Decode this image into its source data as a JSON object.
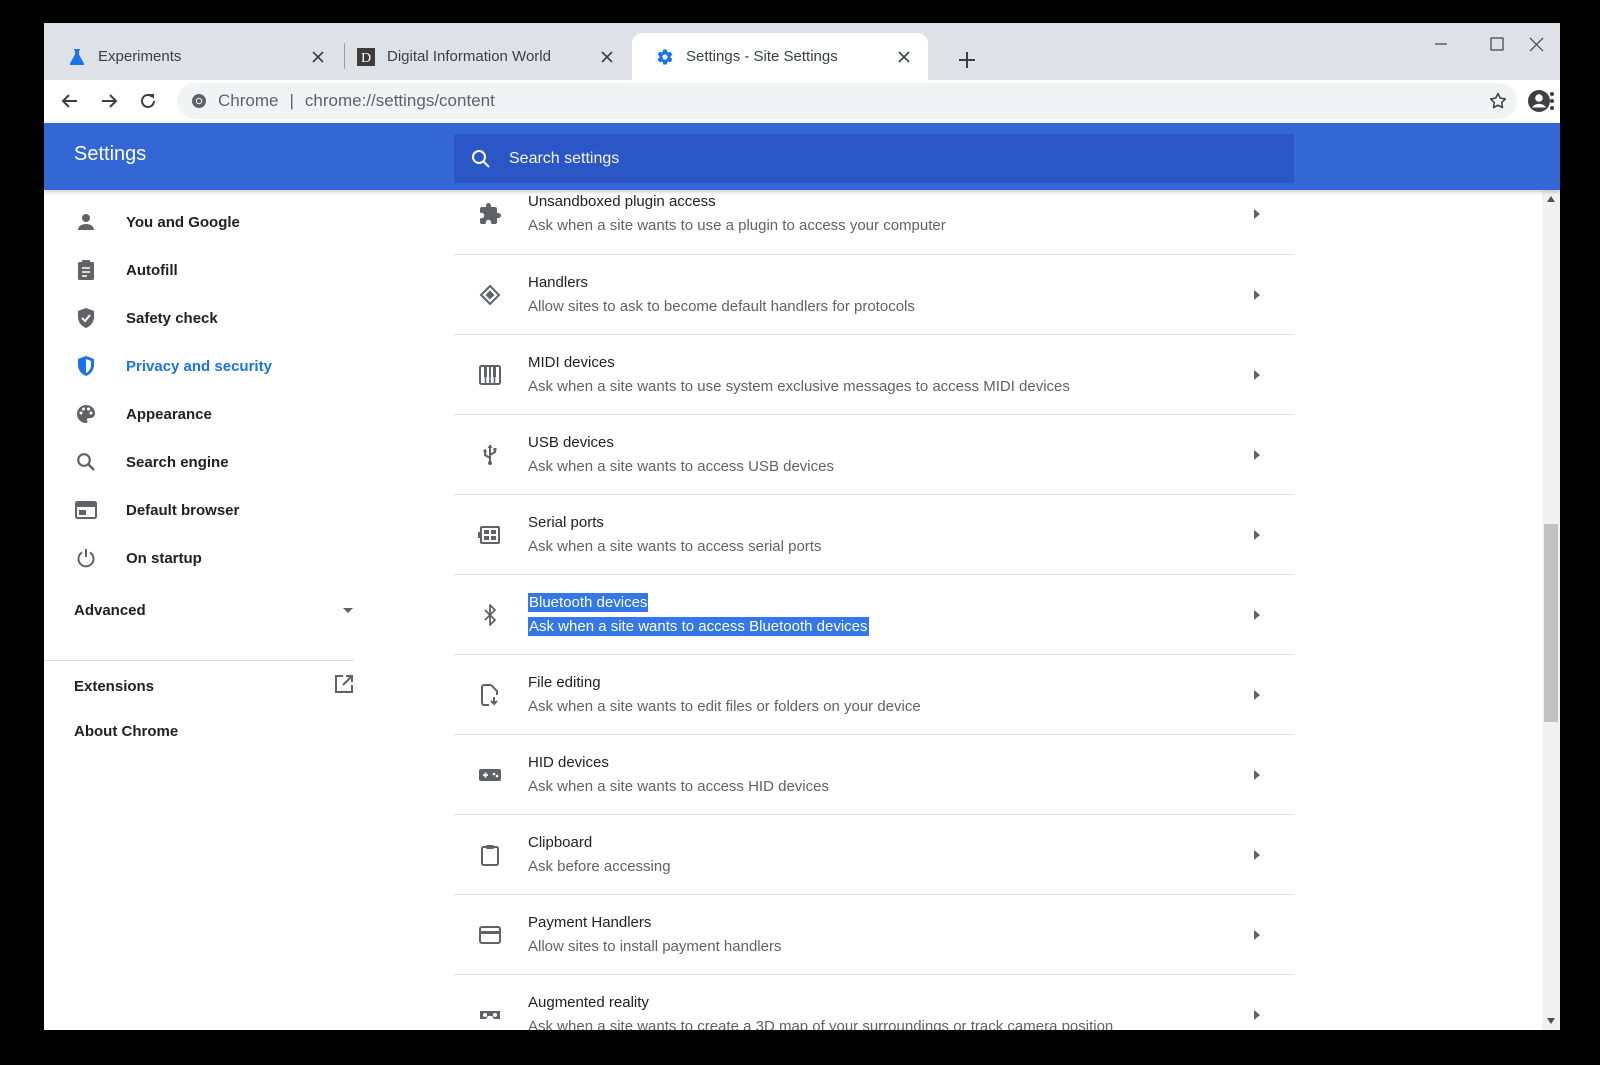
{
  "tabs": [
    {
      "title": "Experiments",
      "icon": "flask-icon"
    },
    {
      "title": "Digital Information World",
      "icon": "site-favicon-d"
    },
    {
      "title": "Settings - Site Settings",
      "icon": "gear-icon",
      "active": true
    }
  ],
  "omnibox": {
    "origin_label": "Chrome",
    "separator": "|",
    "url": "chrome://settings/content"
  },
  "header": {
    "title": "Settings",
    "search_placeholder": "Search settings"
  },
  "sidebar": {
    "items": [
      {
        "label": "You and Google",
        "icon": "person-icon"
      },
      {
        "label": "Autofill",
        "icon": "clipboard-list-icon"
      },
      {
        "label": "Safety check",
        "icon": "shield-check-icon"
      },
      {
        "label": "Privacy and security",
        "icon": "shield-icon",
        "active": true
      },
      {
        "label": "Appearance",
        "icon": "palette-icon"
      },
      {
        "label": "Search engine",
        "icon": "search-icon"
      },
      {
        "label": "Default browser",
        "icon": "browser-window-icon"
      },
      {
        "label": "On startup",
        "icon": "power-icon"
      }
    ],
    "advanced_label": "Advanced",
    "extensions_label": "Extensions",
    "about_label": "About Chrome"
  },
  "settings_rows": [
    {
      "title": "Unsandboxed plugin access",
      "desc": "Ask when a site wants to use a plugin to access your computer",
      "icon": "puzzle-icon"
    },
    {
      "title": "Handlers",
      "desc": "Allow sites to ask to become default handlers for protocols",
      "icon": "handlers-icon"
    },
    {
      "title": "MIDI devices",
      "desc": "Ask when a site wants to use system exclusive messages to access MIDI devices",
      "icon": "piano-icon"
    },
    {
      "title": "USB devices",
      "desc": "Ask when a site wants to access USB devices",
      "icon": "usb-icon"
    },
    {
      "title": "Serial ports",
      "desc": "Ask when a site wants to access serial ports",
      "icon": "serial-port-icon"
    },
    {
      "title": "Bluetooth devices",
      "desc": "Ask when a site wants to access Bluetooth devices",
      "icon": "bluetooth-icon",
      "selected": true
    },
    {
      "title": "File editing",
      "desc": "Ask when a site wants to edit files or folders on your device",
      "icon": "file-edit-icon"
    },
    {
      "title": "HID devices",
      "desc": "Ask when a site wants to access HID devices",
      "icon": "gamepad-icon"
    },
    {
      "title": "Clipboard",
      "desc": "Ask before accessing",
      "icon": "clipboard-icon"
    },
    {
      "title": "Payment Handlers",
      "desc": "Allow sites to install payment handlers",
      "icon": "credit-card-icon"
    },
    {
      "title": "Augmented reality",
      "desc": "Ask when a site wants to create a 3D map of your surroundings or track camera position",
      "icon": "ar-goggles-icon"
    }
  ],
  "colors": {
    "header_blue": "#3367d6",
    "search_blue": "#2a56c6",
    "accent": "#1a73e8",
    "selection": "#3477e7",
    "tabstrip": "#dee1e6"
  }
}
